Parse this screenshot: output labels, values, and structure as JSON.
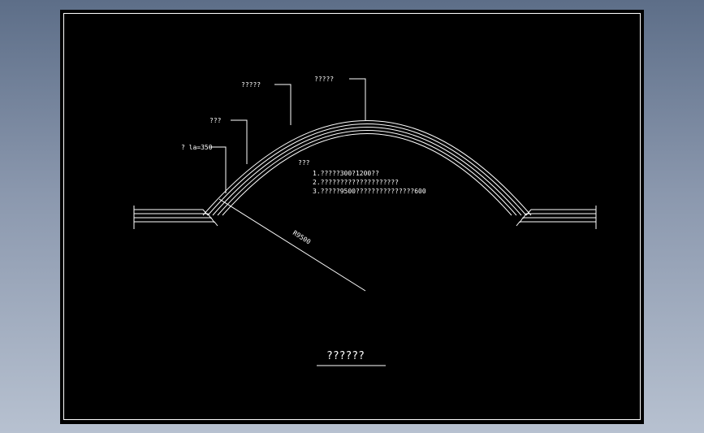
{
  "drawing": {
    "title": "??????",
    "radius_label": "R9500",
    "callouts": {
      "top": "?????",
      "upper": "?????",
      "middle": "???",
      "lower": "? la=350"
    },
    "notes": {
      "heading": "???",
      "lines": [
        "1.?????300?1200??",
        "2.????????????????????",
        "3.?????9500???????????????600"
      ]
    }
  },
  "colors": {
    "background": "#000000",
    "linework": "#ffffff",
    "window_gradient_top": "#5d6e88",
    "window_gradient_bottom": "#b7c1d0"
  }
}
